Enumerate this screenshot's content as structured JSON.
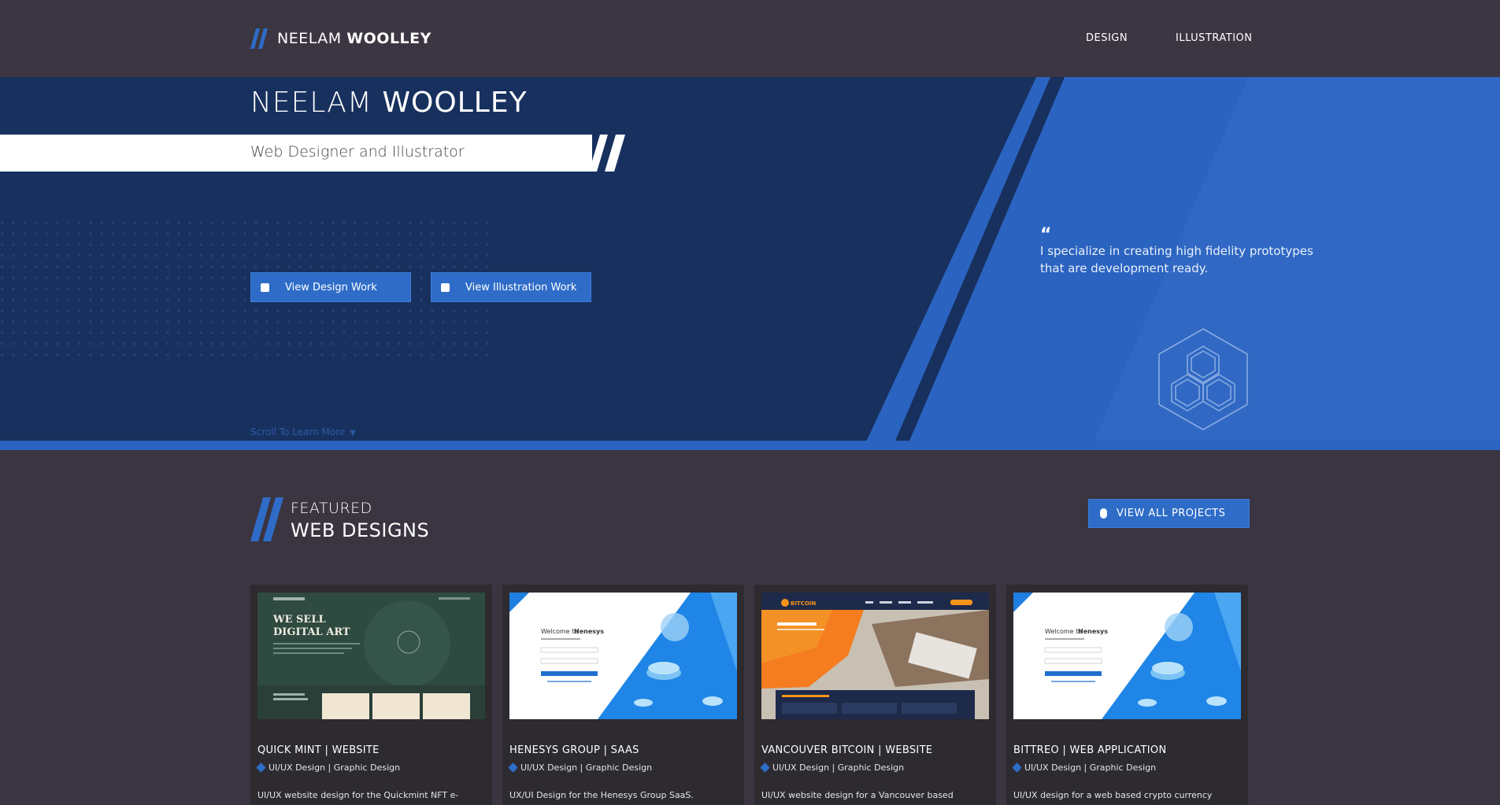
{
  "header": {
    "logo_first": "NEELAM",
    "logo_last": "WOOLLEY",
    "nav": [
      "DESIGN",
      "ILLUSTRATION"
    ]
  },
  "hero": {
    "title_first": "NEELAM",
    "title_last": "WOOLLEY",
    "subtitle": "Web Designer and Illustrator",
    "buttons": [
      "View Design Work",
      "View Illustration Work"
    ],
    "scroll_label": "Scroll To Learn More",
    "quote_mark": "“",
    "quote": "I specialize in creating high fidelity prototypes that are development ready."
  },
  "featured": {
    "small": "FEATURED",
    "big": "WEB DESIGNS",
    "view_all": "VIEW ALL PROJECTS"
  },
  "cards": [
    {
      "title": "QUICK MINT | WEBSITE",
      "tags": "UI/UX Design | Graphic Design",
      "desc": "UI/UX website design for the Quickmint NFT e-",
      "thumb": {
        "headline1": "WE SELL",
        "headline2": "DIGITAL ART"
      }
    },
    {
      "title": "HENESYS GROUP | SAAS",
      "tags": "UI/UX Design | Graphic Design",
      "desc": "UX/UI Design for the Henesys Group SaaS.",
      "thumb": {
        "welcome": "Welcome to",
        "brand": "Henesys"
      }
    },
    {
      "title": "VANCOUVER BITCOIN | WEBSITE",
      "tags": "UI/UX Design | Graphic Design",
      "desc": "UI/UX website design for a Vancouver based",
      "thumb": {
        "brand": "BITCOIN"
      }
    },
    {
      "title": "BITTREO | WEB APPLICATION",
      "tags": "UI/UX Design | Graphic Design",
      "desc": "UI/UX design for a web based crypto currency",
      "thumb": {
        "welcome": "Welcome to",
        "brand": "Henesys"
      }
    }
  ],
  "colors": {
    "accent": "#2e6cc8",
    "hero_dark": "#17305e",
    "page_bg": "#3a3540",
    "card_bg": "#2d2a30"
  }
}
